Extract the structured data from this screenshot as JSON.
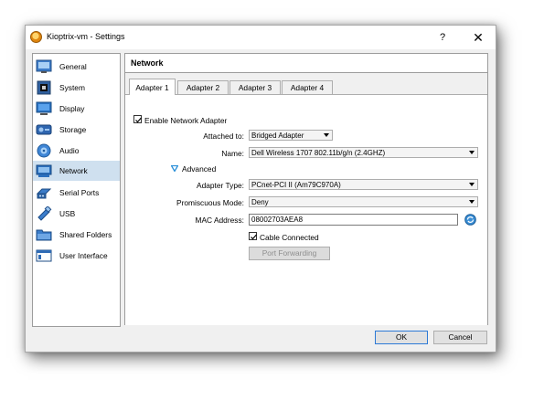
{
  "window": {
    "title": "Kioptrix-vm - Settings",
    "help_label": "?",
    "close_label": "✕"
  },
  "sidebar": {
    "items": [
      {
        "label": "General",
        "icon": "general-icon"
      },
      {
        "label": "System",
        "icon": "system-icon"
      },
      {
        "label": "Display",
        "icon": "display-icon"
      },
      {
        "label": "Storage",
        "icon": "storage-icon"
      },
      {
        "label": "Audio",
        "icon": "audio-icon"
      },
      {
        "label": "Network",
        "icon": "network-icon",
        "selected": true
      },
      {
        "label": "Serial Ports",
        "icon": "serial-ports-icon"
      },
      {
        "label": "USB",
        "icon": "usb-icon"
      },
      {
        "label": "Shared Folders",
        "icon": "shared-folders-icon"
      },
      {
        "label": "User Interface",
        "icon": "user-interface-icon"
      }
    ]
  },
  "content": {
    "header": "Network",
    "tabs": [
      {
        "label": "Adapter 1",
        "active": true
      },
      {
        "label": "Adapter 2"
      },
      {
        "label": "Adapter 3"
      },
      {
        "label": "Adapter 4"
      }
    ],
    "enable_adapter_label": "Enable Network Adapter",
    "enable_adapter_checked": true,
    "attached_to_label": "Attached to:",
    "attached_to_value": "Bridged Adapter",
    "name_label": "Name:",
    "name_value": "Dell Wireless 1707 802.11b/g/n (2.4GHZ)",
    "advanced_label": "Advanced",
    "adapter_type_label": "Adapter Type:",
    "adapter_type_value": "PCnet-PCI II (Am79C970A)",
    "promiscuous_label": "Promiscuous Mode:",
    "promiscuous_value": "Deny",
    "mac_label": "MAC Address:",
    "mac_value": "08002703AEA8",
    "cable_connected_label": "Cable Connected",
    "cable_connected_checked": true,
    "port_forwarding_label": "Port Forwarding"
  },
  "buttons": {
    "ok": "OK",
    "cancel": "Cancel"
  },
  "colors": {
    "selection": "#cfe0ef",
    "accent": "#2d7ad6",
    "advanced_arrow": "#2a8fd8"
  }
}
